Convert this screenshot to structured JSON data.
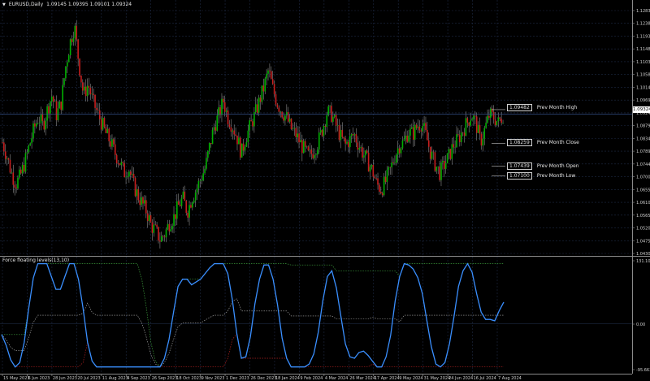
{
  "header": {
    "symbol": "EURUSD,Daily",
    "ohlc": "1.09145 1.09395 1.09101 1.09324"
  },
  "indicator": {
    "title": "Force floating levels(13,10)"
  },
  "current_price": "1.09324",
  "price_levels": [
    {
      "price": "1.09482",
      "name": "Prev Month High"
    },
    {
      "price": "1.08259",
      "name": "Prev Month Close"
    },
    {
      "price": "1.07439",
      "name": "Prev Month Open"
    },
    {
      "price": "1.07100",
      "name": "Prev Month Low"
    }
  ],
  "price_axis": [
    "1.12830",
    "1.12380",
    "1.11930",
    "1.11480",
    "1.11030",
    "1.10580",
    "1.10140",
    "1.09690",
    "1.09240",
    "1.08790",
    "1.08340",
    "1.07890",
    "1.07440",
    "1.07000",
    "1.06550",
    "1.06100",
    "1.05650",
    "1.05200",
    "1.04750",
    "1.04300"
  ],
  "indicator_axis": [
    "131.101",
    "0.00",
    "-95.6634"
  ],
  "date_axis": [
    "15 May 2023",
    "6 Jun 2023",
    "28 Jun 2023",
    "20 Jul 2023",
    "11 Aug 2023",
    "4 Sep 2023",
    "26 Sep 2023",
    "18 Oct 2023",
    "9 Nov 2023",
    "1 Dec 2023",
    "26 Dec 2023",
    "18 Jan 2024",
    "9 Feb 2024",
    "4 Mar 2024",
    "26 Mar 2024",
    "17 Apr 2024",
    "9 May 2024",
    "31 May 2024",
    "24 Jun 2024",
    "16 Jul 2024",
    "7 Aug 2024"
  ],
  "colors": {
    "bull": "#00b000",
    "bear": "#c81e1e",
    "wick": "#cfcfcf",
    "grid": "#1e2a44",
    "force": "#3a8fff",
    "upper": "#3c9c3c",
    "middle": "#b0b0b0",
    "lower": "#b02020"
  },
  "chart_data": {
    "type": "candlestick",
    "series_close_path": [
      1.083,
      1.078,
      1.072,
      1.068,
      1.071,
      1.076,
      1.082,
      1.088,
      1.092,
      1.089,
      1.095,
      1.1,
      1.093,
      1.097,
      1.11,
      1.119,
      1.125,
      1.111,
      1.1,
      1.104,
      1.098,
      1.094,
      1.09,
      1.086,
      1.083,
      1.079,
      1.076,
      1.072,
      1.074,
      1.068,
      1.064,
      1.061,
      1.058,
      1.053,
      1.051,
      1.048,
      1.05,
      1.054,
      1.056,
      1.06,
      1.063,
      1.058,
      1.063,
      1.066,
      1.07,
      1.074,
      1.082,
      1.089,
      1.093,
      1.098,
      1.092,
      1.089,
      1.085,
      1.079,
      1.085,
      1.089,
      1.093,
      1.098,
      1.103,
      1.109,
      1.102,
      1.097,
      1.094,
      1.092,
      1.088,
      1.086,
      1.083,
      1.08,
      1.078,
      1.08,
      1.083,
      1.088,
      1.094,
      1.093,
      1.089,
      1.085,
      1.082,
      1.084,
      1.086,
      1.082,
      1.079,
      1.076,
      1.073,
      1.068,
      1.066,
      1.069,
      1.073,
      1.078,
      1.082,
      1.083,
      1.087,
      1.086,
      1.089,
      1.09,
      1.085,
      1.079,
      1.075,
      1.072,
      1.075,
      1.078,
      1.082,
      1.084,
      1.087,
      1.09,
      1.093,
      1.09,
      1.083,
      1.088,
      1.093,
      1.092,
      1.09,
      1.093
    ],
    "ylim": [
      1.043,
      1.1305
    ],
    "indicator_ylim": [
      -95.6634,
      131.101
    ]
  }
}
